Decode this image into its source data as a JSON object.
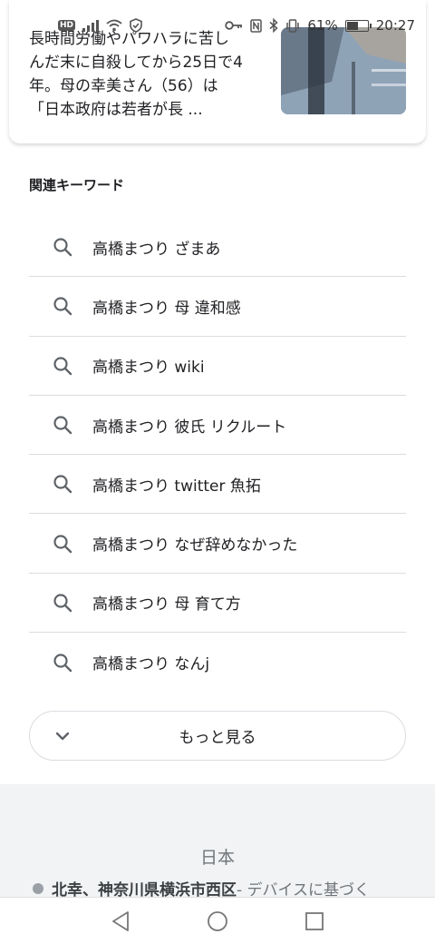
{
  "status_bar": {
    "hd_label": "HD",
    "battery_percent": "61%",
    "battery_level": 0.61,
    "time": "20:27",
    "icons": [
      "signal-icon",
      "wifi-icon",
      "vpn-shield-icon",
      "key-icon",
      "nfc-icon",
      "bluetooth-icon",
      "vibrate-icon",
      "battery-icon"
    ]
  },
  "result_card": {
    "snippet": "長時間労働やパワハラに苦し\nんだ末に自殺してから25日で4\n年。母の幸美さん（56）は\n「日本政府は若者が長 ..."
  },
  "related": {
    "heading": "関連キーワード",
    "items": [
      {
        "label": "高橋まつり ざまあ"
      },
      {
        "label": "高橋まつり 母 違和感"
      },
      {
        "label": "高橋まつり wiki"
      },
      {
        "label": "高橋まつり 彼氏 リクルート"
      },
      {
        "label": "高橋まつり twitter 魚拓"
      },
      {
        "label": "高橋まつり なぜ辞めなかった"
      },
      {
        "label": "高橋まつり 母 育て方"
      },
      {
        "label": "高橋まつり なんj"
      }
    ],
    "more_label": "もっと見る"
  },
  "footer": {
    "country": "日本",
    "location_name": "北幸、神奈川県横浜市西区",
    "location_source": " - デバイスに基づく"
  },
  "colors": {
    "icon_gray": "#5f6368",
    "divider": "#dadce0",
    "footer_bg": "#f1f3f4"
  }
}
